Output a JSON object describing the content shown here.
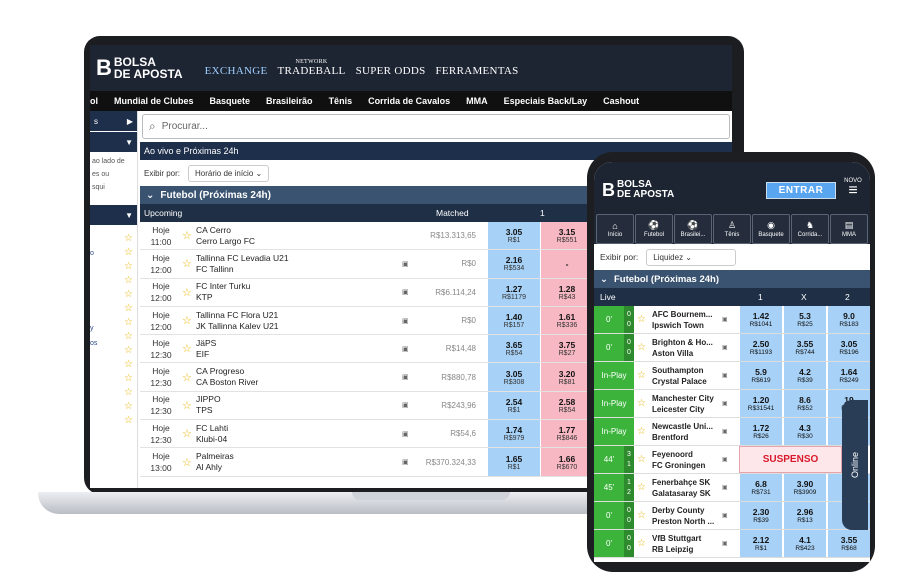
{
  "laptop": {
    "logo": {
      "letter": "B",
      "line1": "BOLSA",
      "line2": "DE APOSTA"
    },
    "nav": {
      "exchange": "EXCHANGE",
      "network": "NETWORK",
      "tradeball": "TRADEBALL",
      "superodds": "SUPER ODDS",
      "ferramentas": "FERRAMENTAS"
    },
    "categories": [
      "ol",
      "Mundial de Clubes",
      "Basquete",
      "Brasileirão",
      "Tênis",
      "Corrida de Cavalos",
      "MMA",
      "Especiais Back/Lay",
      "Cashout"
    ],
    "sidebar": {
      "bar1": "s",
      "bar2": "",
      "text": [
        "ao lado de",
        "es ou",
        "squi"
      ],
      "links": [
        "",
        "o",
        "",
        "",
        "",
        "",
        "y",
        "os"
      ]
    },
    "search_placeholder": "Procurar...",
    "live_bar": "Ao vivo e Próximas 24h",
    "filter_label": "Exibir por:",
    "filter_value": "Horário de início",
    "section": "Futebol (Próximas 24h)",
    "col_upcoming": "Upcoming",
    "col_matched": "Matched",
    "col_1": "1",
    "rows": [
      {
        "d": "Hoje",
        "t": "11:00",
        "a": "CA Cerro",
        "b": "Cerro Largo FC",
        "m": "R$13.313,65",
        "b1": "3.05",
        "b1s": "R$1",
        "l1": "3.15",
        "l1s": "R$551"
      },
      {
        "d": "Hoje",
        "t": "12:00",
        "a": "Tallinna FC Levadia U21",
        "b": "FC Tallinn",
        "m": "R$0",
        "b1": "2.16",
        "b1s": "R$534",
        "l1": "-",
        "l1s": ""
      },
      {
        "d": "Hoje",
        "t": "12:00",
        "a": "FC Inter Turku",
        "b": "KTP",
        "m": "R$6.114,24",
        "b1": "1.27",
        "b1s": "R$1179",
        "l1": "1.28",
        "l1s": "R$43"
      },
      {
        "d": "Hoje",
        "t": "12:00",
        "a": "Tallinna FC Flora U21",
        "b": "JK Tallinna Kalev U21",
        "m": "R$0",
        "b1": "1.40",
        "b1s": "R$157",
        "l1": "1.61",
        "l1s": "R$336"
      },
      {
        "d": "Hoje",
        "t": "12:30",
        "a": "JäPS",
        "b": "EIF",
        "m": "R$14,48",
        "b1": "3.65",
        "b1s": "R$54",
        "l1": "3.75",
        "l1s": "R$27"
      },
      {
        "d": "Hoje",
        "t": "12:30",
        "a": "CA Progreso",
        "b": "CA Boston River",
        "m": "R$880,78",
        "b1": "3.05",
        "b1s": "R$308",
        "l1": "3.20",
        "l1s": "R$81"
      },
      {
        "d": "Hoje",
        "t": "12:30",
        "a": "JIPPO",
        "b": "TPS",
        "m": "R$243,96",
        "b1": "2.54",
        "b1s": "R$1",
        "l1": "2.58",
        "l1s": "R$54"
      },
      {
        "d": "Hoje",
        "t": "12:30",
        "a": "FC Lahti",
        "b": "Klubi-04",
        "m": "R$54,6",
        "b1": "1.74",
        "b1s": "R$979",
        "l1": "1.77",
        "l1s": "R$846"
      },
      {
        "d": "Hoje",
        "t": "13:00",
        "a": "Palmeiras",
        "b": "Al Ahly",
        "m": "R$370.324,33",
        "b1": "1.65",
        "b1s": "R$1",
        "l1": "1.66",
        "l1s": "R$670"
      }
    ]
  },
  "phone": {
    "logo": {
      "letter": "B",
      "line1": "BOLSA",
      "line2": "DE APOSTA"
    },
    "entrar": "ENTRAR",
    "menu": "NOVO",
    "icons": [
      {
        "i": "⌂",
        "l": "Início"
      },
      {
        "i": "⚽",
        "l": "Futebol"
      },
      {
        "i": "⚽",
        "l": "Brasilei..."
      },
      {
        "i": "♙",
        "l": "Tênis"
      },
      {
        "i": "◉",
        "l": "Basquete"
      },
      {
        "i": "♞",
        "l": "Corrida..."
      },
      {
        "i": "▤",
        "l": "MMA"
      }
    ],
    "filter_label": "Exibir por:",
    "filter_value": "Liquidez",
    "section": "Futebol (Próximas 24h)",
    "col_live": "Live",
    "cols": [
      "1",
      "X",
      "2"
    ],
    "suspended": "SUSPENSO",
    "online": "Online",
    "rows": [
      {
        "s": "0'",
        "h": "0",
        "a": "0",
        "t1": "AFC Bournem...",
        "t2": "Ipswich Town",
        "o": [
          [
            "1.42",
            "R$1041"
          ],
          [
            "5.3",
            "R$25"
          ],
          [
            "9.0",
            "R$183"
          ]
        ]
      },
      {
        "s": "0'",
        "h": "0",
        "a": "0",
        "t1": "Brighton & Ho...",
        "t2": "Aston Villa",
        "o": [
          [
            "2.50",
            "R$1193"
          ],
          [
            "3.55",
            "R$744"
          ],
          [
            "3.05",
            "R$196"
          ]
        ]
      },
      {
        "s": "In-Play",
        "h": "",
        "a": "",
        "t1": "Southampton",
        "t2": "Crystal Palace",
        "o": [
          [
            "5.9",
            "R$619"
          ],
          [
            "4.2",
            "R$39"
          ],
          [
            "1.64",
            "R$249"
          ]
        ]
      },
      {
        "s": "In-Play",
        "h": "",
        "a": "",
        "t1": "Manchester City",
        "t2": "Leicester City",
        "o": [
          [
            "1.20",
            "R$31541"
          ],
          [
            "8.6",
            "R$52"
          ],
          [
            "19",
            "R$56"
          ]
        ]
      },
      {
        "s": "In-Play",
        "h": "",
        "a": "",
        "t1": "Newcastle Uni...",
        "t2": "Brentford",
        "o": [
          [
            "1.72",
            "R$26"
          ],
          [
            "4.3",
            "R$30"
          ],
          [
            "",
            ""
          ]
        ]
      },
      {
        "s": "44'",
        "h": "3",
        "a": "1",
        "t1": "Feyenoord",
        "t2": "FC Groningen",
        "o": [
          [
            "1.16",
            ""
          ],
          [
            "",
            ""
          ],
          [
            "",
            ""
          ]
        ],
        "susp": true
      },
      {
        "s": "45'",
        "h": "1",
        "a": "2",
        "t1": "Fenerbahçe SK",
        "t2": "Galatasaray SK",
        "o": [
          [
            "6.8",
            "R$731"
          ],
          [
            "3.90",
            "R$3909"
          ],
          [
            "",
            ""
          ]
        ]
      },
      {
        "s": "0'",
        "h": "0",
        "a": "0",
        "t1": "Derby County",
        "t2": "Preston North ...",
        "o": [
          [
            "2.30",
            "R$39"
          ],
          [
            "2.96",
            "R$13"
          ],
          [
            "",
            ""
          ]
        ]
      },
      {
        "s": "0'",
        "h": "0",
        "a": "0",
        "t1": "VfB Stuttgart",
        "t2": "RB Leipzig",
        "o": [
          [
            "2.12",
            "R$1"
          ],
          [
            "4.1",
            "R$423"
          ],
          [
            "3.55",
            "R$68"
          ]
        ]
      }
    ]
  }
}
